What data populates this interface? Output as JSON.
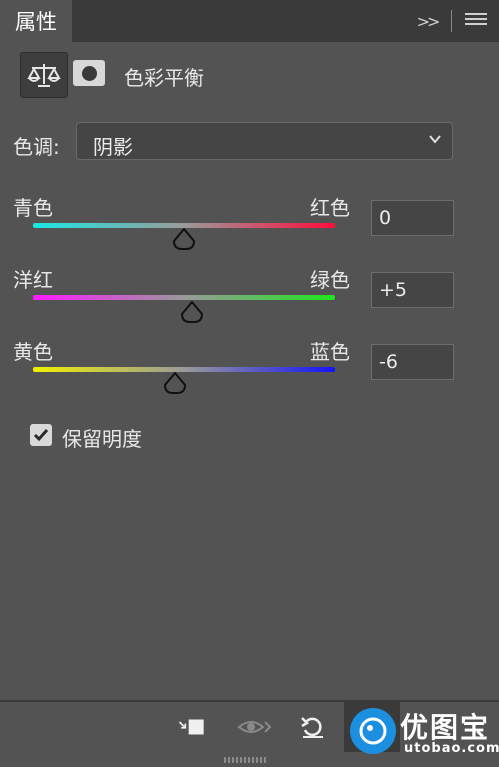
{
  "tab": {
    "title": "属性"
  },
  "header": {
    "title": "色彩平衡",
    "adjustment_icon": "balance-scale-icon",
    "mask_icon": "layer-mask-icon"
  },
  "tone": {
    "label": "色调:",
    "value": "阴影"
  },
  "sliders": [
    {
      "left": "青色",
      "right": "红色",
      "value": "0",
      "position_fraction": 0.5,
      "gradient": [
        "#19e8e6",
        "#ff0d3c"
      ]
    },
    {
      "left": "洋红",
      "right": "绿色",
      "value": "+5",
      "position_fraction": 0.525,
      "gradient": [
        "#ff19ff",
        "#1ee61e"
      ]
    },
    {
      "left": "黄色",
      "right": "蓝色",
      "value": "-6",
      "position_fraction": 0.47,
      "gradient": [
        "#f0f000",
        "#1414f5"
      ]
    }
  ],
  "preserve_luminosity": {
    "label": "保留明度",
    "checked": true
  },
  "toolbar": {
    "buttons": [
      "clip-to-layer-icon",
      "view-previous-state-icon",
      "reset-icon",
      "visibility-eye-icon"
    ]
  },
  "watermark": {
    "name": "优图宝",
    "url": "utobao.com"
  },
  "colors": {
    "panel": "#535353",
    "tabbar": "#3a3a3a",
    "field": "#454545"
  }
}
